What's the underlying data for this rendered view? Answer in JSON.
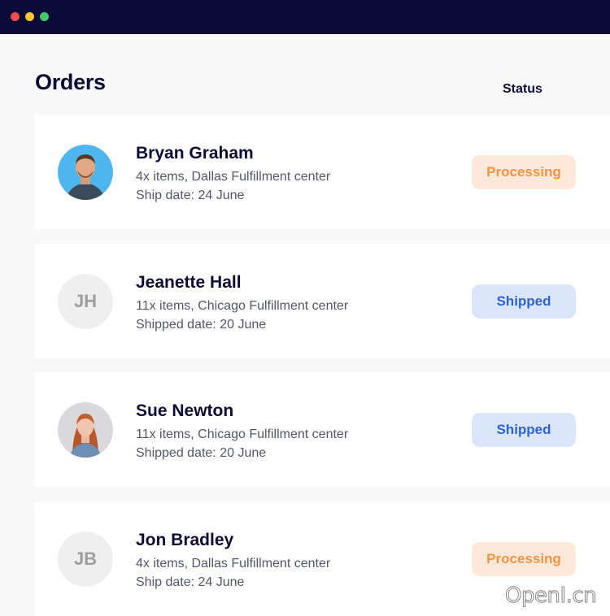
{
  "window": {
    "controls": [
      "close",
      "minimize",
      "maximize"
    ],
    "colors": {
      "titlebar": "#0c0a36",
      "close": "#ee4a4f",
      "minimize": "#f7c52f",
      "maximize": "#3fcb6a"
    }
  },
  "header": {
    "title": "Orders",
    "status_label": "Status"
  },
  "orders": [
    {
      "name": "Bryan Graham",
      "items": "4x items, Dallas Fulfillment center",
      "date": "Ship date: 24 June",
      "status": "Processing",
      "avatar": "photo"
    },
    {
      "name": "Jeanette Hall",
      "items": "11x items, Chicago Fulfillment center",
      "date": "Shipped date: 20 June",
      "status": "Shipped",
      "avatar": "initials",
      "initials": "JH"
    },
    {
      "name": "Sue Newton",
      "items": "11x items, Chicago Fulfillment center",
      "date": "Shipped date: 20 June",
      "status": "Shipped",
      "avatar": "photo"
    },
    {
      "name": "Jon Bradley",
      "items": "4x items, Dallas Fulfillment center",
      "date": "Ship date: 24 June",
      "status": "Processing",
      "avatar": "initials",
      "initials": "JB"
    }
  ],
  "status_colors": {
    "processing": {
      "bg": "#fde8da",
      "text": "#f39443"
    },
    "shipped": {
      "bg": "#dce6fb",
      "text": "#2e63d8"
    }
  },
  "watermark": "OpenI.cn"
}
